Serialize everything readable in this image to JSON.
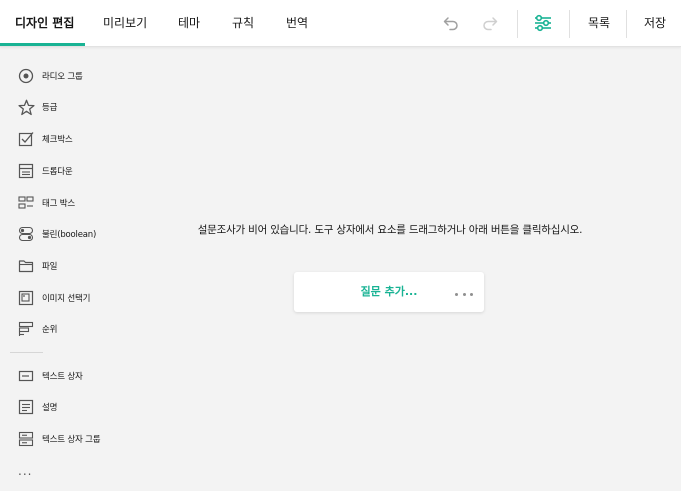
{
  "tabs": [
    {
      "label": "디자인 편집",
      "active": true
    },
    {
      "label": "미리보기",
      "active": false
    },
    {
      "label": "테마",
      "active": false
    },
    {
      "label": "규칙",
      "active": false
    },
    {
      "label": "번역",
      "active": false
    }
  ],
  "toolbar": {
    "undo_icon": "undo-icon",
    "redo_icon": "redo-icon",
    "settings_icon": "settings-sliders-icon",
    "list_label": "목록",
    "save_label": "저장"
  },
  "toolbox": {
    "items": [
      {
        "label": "라디오 그룹",
        "icon": "radio-group-icon"
      },
      {
        "label": "등급",
        "icon": "star-icon"
      },
      {
        "label": "체크박스",
        "icon": "checkbox-icon"
      },
      {
        "label": "드롭다운",
        "icon": "dropdown-icon"
      },
      {
        "label": "태그 박스",
        "icon": "tag-box-icon"
      },
      {
        "label": "불린(boolean)",
        "icon": "toggle-icon"
      },
      {
        "label": "파일",
        "icon": "folder-icon"
      },
      {
        "label": "이미지 선택기",
        "icon": "image-picker-icon"
      },
      {
        "label": "순위",
        "icon": "ranking-icon"
      },
      {
        "label": "텍스트 상자",
        "icon": "text-input-icon"
      },
      {
        "label": "설명",
        "icon": "comment-icon"
      },
      {
        "label": "텍스트 상자 그룹",
        "icon": "multiple-text-icon"
      }
    ],
    "more": "..."
  },
  "canvas": {
    "empty_message": "설문조사가 비어 있습니다. 도구 상자에서 요소를 드래그하거나 아래 버튼을 클릭하십시오.",
    "add_question_label": "질문 추가..."
  },
  "colors": {
    "accent": "#19b394",
    "background": "#f3f3f3",
    "text": "#161616"
  }
}
